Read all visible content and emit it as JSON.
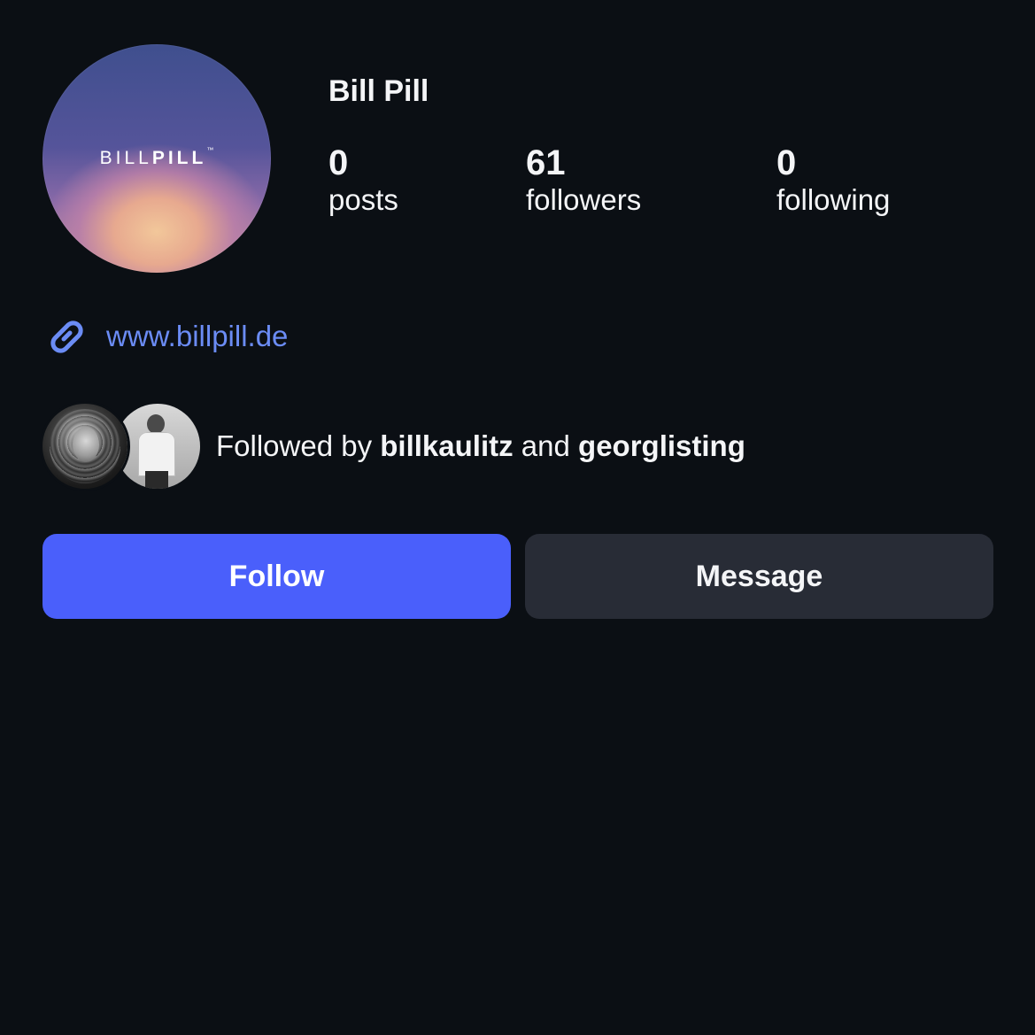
{
  "profile": {
    "display_name": "Bill Pill",
    "avatar_logo": {
      "light_text": "BILL",
      "bold_text": "PILL",
      "trademark": "™"
    },
    "stats": {
      "posts": {
        "count": "0",
        "label": "posts"
      },
      "followers": {
        "count": "61",
        "label": "followers"
      },
      "following": {
        "count": "0",
        "label": "following"
      }
    }
  },
  "website": {
    "url_text": "www.billpill.de",
    "icon": "link-icon"
  },
  "followed_by": {
    "prefix": "Followed by",
    "user1": "billkaulitz",
    "conjunction": "and",
    "user2": "georglisting"
  },
  "actions": {
    "follow_label": "Follow",
    "message_label": "Message"
  },
  "colors": {
    "background": "#0b0f14",
    "text": "#f4f5f7",
    "link": "#6b8cf5",
    "follow_button": "#4a5ffb",
    "message_button": "#282c36"
  }
}
